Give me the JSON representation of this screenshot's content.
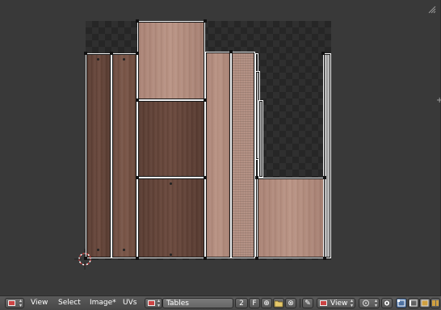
{
  "header": {
    "menus": [
      "View",
      "Select",
      "Image*",
      "UVs"
    ],
    "image_name": "Tables",
    "users_count": "2",
    "fake_user_label": "F",
    "display_channel": "View"
  },
  "colors": {
    "viewport_bg": "#393939",
    "header_bg": "#4b4b4b",
    "uv_edge": "#f2f2f2",
    "cursor_red": "#d23c3c"
  },
  "icons": {
    "editor_type": "uv-image-editor-icon",
    "new_image": "plus-icon",
    "open_image": "folder-icon",
    "unlink": "x-icon",
    "pin": "pin-icon",
    "pivot": "pivot-icon",
    "sticky_selection": "sticky-icon",
    "select_modes": [
      "vertex-select-icon",
      "edge-select-icon",
      "face-select-icon",
      "island-select-icon"
    ]
  }
}
